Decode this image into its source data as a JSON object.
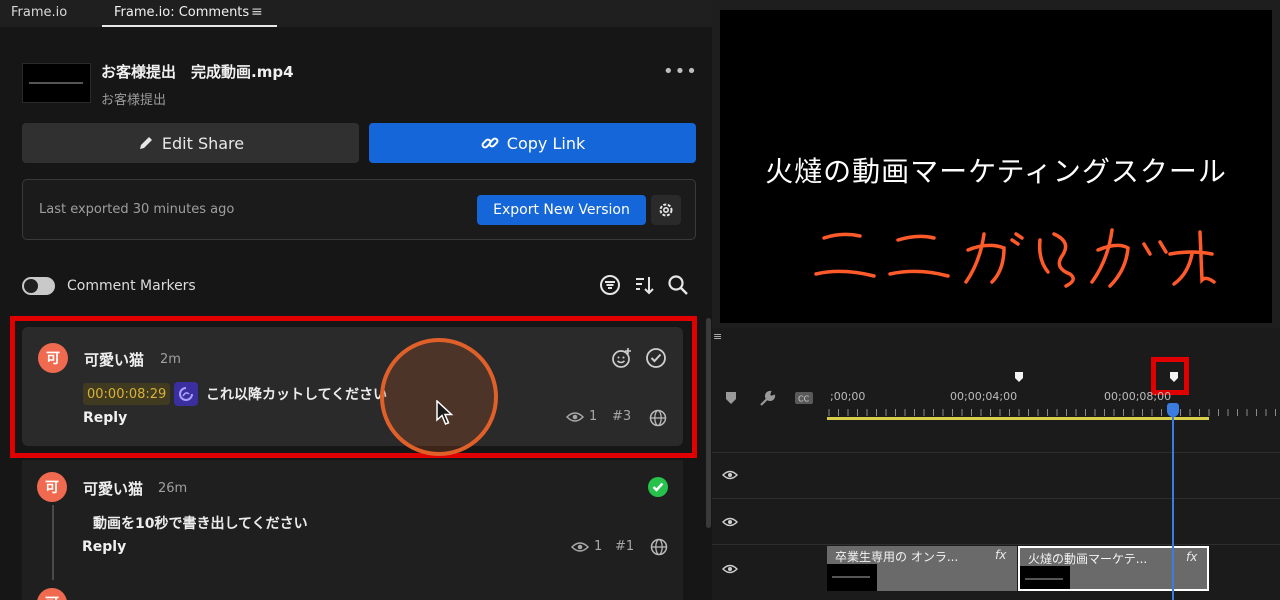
{
  "tabs": [
    "Frame.io",
    "Frame.io: Comments"
  ],
  "file": {
    "name": "お客様提出　完成動画.mp4",
    "subtitle": "お客様提出"
  },
  "buttons": {
    "edit_share": "Edit Share",
    "copy_link": "Copy Link"
  },
  "export": {
    "status": "Last exported 30 minutes ago",
    "button": "Export New Version"
  },
  "comment_markers_label": "Comment Markers",
  "comments": [
    {
      "avatar": "可",
      "author": "可愛い猫",
      "time": "2m",
      "timecode": "00:00:08:29",
      "text": "これ以降カットしてください",
      "reply": "Reply",
      "views": "1",
      "number": "#3"
    },
    {
      "avatar": "可",
      "author": "可愛い猫",
      "time": "26m",
      "text": "動画を10秒で書き出してください",
      "reply": "Reply",
      "views": "1",
      "number": "#1",
      "resolved": true
    }
  ],
  "third_avatar": "可",
  "video": {
    "title": "火燵の動画マーケティングスクール",
    "handwriting": "ここから カット",
    "handwriting_color": "#ff5a2a"
  },
  "timeline": {
    "timecodes": [
      ";00;00",
      "00;00;04;00",
      "00;00;08;00"
    ],
    "clips": [
      {
        "name": "卒業生専用の オンラ...",
        "fx": "fx"
      },
      {
        "name": "火燵の動画マーケテ...",
        "fx": "fx"
      }
    ]
  },
  "colors": {
    "accent": "#1566d8",
    "avatar": "#ef6a4f",
    "highlight": "#e00000",
    "resolved": "#27c24c",
    "playhead": "#3a7ce0"
  }
}
